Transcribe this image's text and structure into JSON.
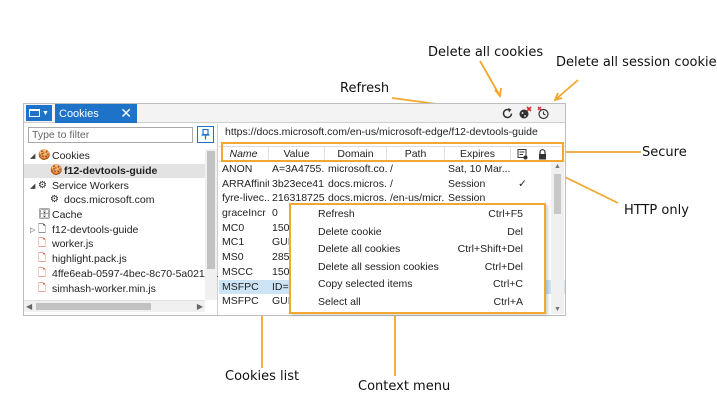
{
  "annotations": {
    "delete_all": "Delete all cookies",
    "delete_session": "Delete all session cookies",
    "refresh": "Refresh",
    "secure": "Secure",
    "http_only": "HTTP only",
    "cookies_list": "Cookies list",
    "context_menu": "Context menu"
  },
  "tab": {
    "label": "Cookies",
    "close": "✕"
  },
  "filter": {
    "placeholder": "Type to filter"
  },
  "tree": [
    {
      "label": "Cookies",
      "icon": "cookie-icon",
      "expanded": true
    },
    {
      "label": "f12-devtools-guide",
      "icon": "cookie-icon",
      "selected": true
    },
    {
      "label": "Service Workers",
      "icon": "gear-icon",
      "expanded": true
    },
    {
      "label": "docs.microsoft.com",
      "icon": "gear-icon"
    },
    {
      "label": "Cache",
      "icon": "database-icon"
    },
    {
      "label": "f12-devtools-guide",
      "icon": "document-icon",
      "expanded": false
    },
    {
      "label": "worker.js",
      "icon": "script-icon"
    },
    {
      "label": "highlight.pack.js",
      "icon": "script-icon"
    },
    {
      "label": "4ffe6eab-0597-4bec-8c70-5a0211f1b",
      "icon": "script-icon"
    },
    {
      "label": "simhash-worker.min.js",
      "icon": "script-icon"
    }
  ],
  "url": "https://docs.microsoft.com/en-us/microsoft-edge/f12-devtools-guide",
  "columns": {
    "name": "Name",
    "value": "Value",
    "domain": "Domain",
    "path": "Path",
    "expires": "Expires"
  },
  "rows": [
    {
      "name": "ANON",
      "value": "A=3A4755...",
      "domain": "microsoft.co...",
      "path": "/",
      "expires": "Sat, 10 Mar...",
      "http": "",
      "secure": ""
    },
    {
      "name": "ARRAffinity",
      "value": "3b23ece41...",
      "domain": "docs.micros...",
      "path": "/",
      "expires": "Session",
      "http": "✓",
      "secure": ""
    },
    {
      "name": "fyre-livec...",
      "value": "216318725...",
      "domain": "docs.micros...",
      "path": "/en-us/micr...",
      "expires": "Session",
      "http": "",
      "secure": ""
    },
    {
      "name": "graceIncr",
      "value": "0",
      "domain": "",
      "path": "",
      "expires": "",
      "http": "",
      "secure": ""
    },
    {
      "name": "MC0",
      "value": "1506",
      "domain": "",
      "path": "",
      "expires": "",
      "http": "",
      "secure": ""
    },
    {
      "name": "MC1",
      "value": "GUID",
      "domain": "",
      "path": "",
      "expires": "",
      "http": "",
      "secure": ""
    },
    {
      "name": "MS0",
      "value": "2858",
      "domain": "",
      "path": "",
      "expires": "",
      "http": "",
      "secure": ""
    },
    {
      "name": "MSCC",
      "value": "1506",
      "domain": "",
      "path": "",
      "expires": "",
      "http": "",
      "secure": ""
    },
    {
      "name": "MSFPC",
      "value": "ID=b",
      "domain": "",
      "path": "",
      "expires": "",
      "http": "",
      "secure": "",
      "selected": true
    },
    {
      "name": "MSFPC",
      "value": "GUID",
      "domain": "",
      "path": "",
      "expires": "",
      "http": "",
      "secure": ""
    }
  ],
  "context_menu": [
    {
      "label": "Refresh",
      "shortcut": "Ctrl+F5"
    },
    {
      "label": "Delete cookie",
      "shortcut": "Del"
    },
    {
      "label": "Delete all cookies",
      "shortcut": "Ctrl+Shift+Del"
    },
    {
      "label": "Delete all session cookies",
      "shortcut": "Ctrl+Del"
    },
    {
      "label": "Copy selected items",
      "shortcut": "Ctrl+C"
    },
    {
      "label": "Select all",
      "shortcut": "Ctrl+A"
    }
  ],
  "colors": {
    "accent": "#1e73c8",
    "highlight": "#f0a830",
    "selection": "#cde4f7"
  }
}
